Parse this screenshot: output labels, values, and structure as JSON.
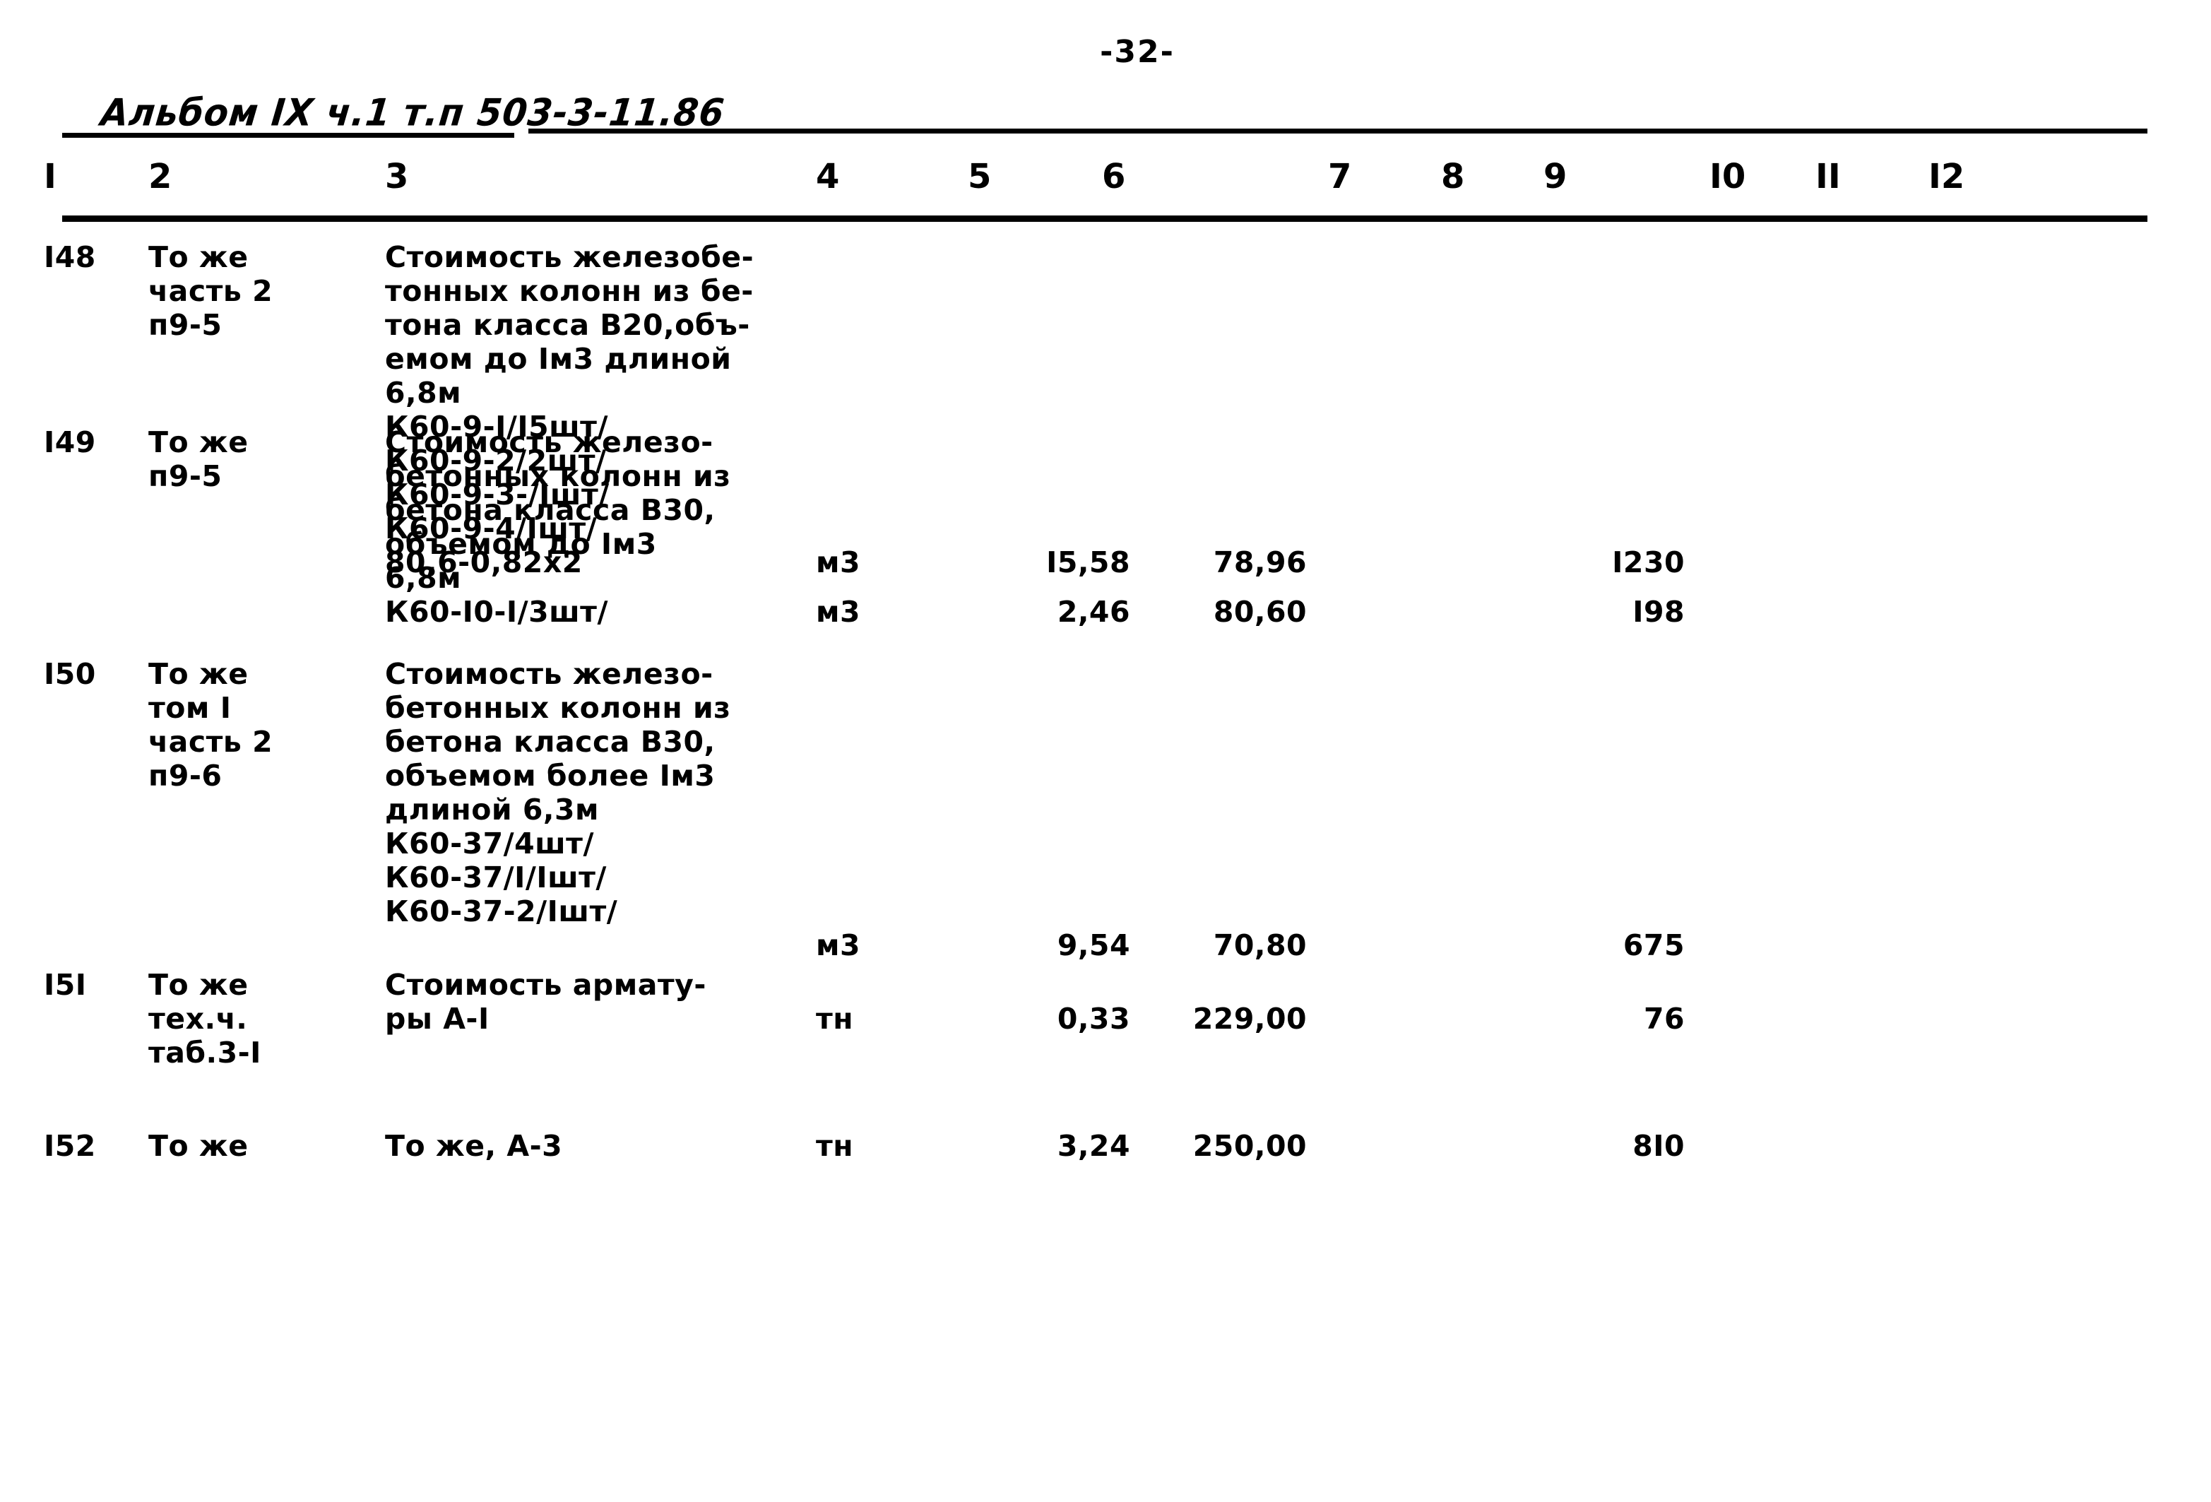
{
  "page": {
    "page_number": "-32-",
    "album_caption": "Альбом IX ч.1 т.п 503-3-11.86"
  },
  "table": {
    "column_headers": [
      "I",
      "2",
      "3",
      "4",
      "5",
      "6",
      "7",
      "8",
      "9",
      "I0",
      "II",
      "I2"
    ],
    "rows": [
      {
        "c1": "I48",
        "c2": "То же\nчасть 2\nп9-5",
        "c3": "Стоимость железобе-\nтонных колонн из бе-\nтона класса В20,объ-\nемом до Iм3 длиной\n6,8м\nК60-9-I/I5шт/\nК60-9-2/2шт/\nК60-9-3-/Iшт/\nК60-9-4/Iшт/\n80,6-0,82х2",
        "c4": "м3",
        "c5": "I5,58",
        "c6": "78,96",
        "c7": "",
        "c8": "",
        "c9": "I230",
        "c10": "",
        "c11": "",
        "c12": ""
      },
      {
        "c1": "I49",
        "c2": "То же\nп9-5",
        "c3": "Стоимость железо-\nбетонных колонн из\nбетона класса В30,\nобъемом до Iм3\n6,8м\nК60-I0-I/3шт/",
        "c4": "м3",
        "c5": "2,46",
        "c6": "80,60",
        "c7": "",
        "c8": "",
        "c9": "I98",
        "c10": "",
        "c11": "",
        "c12": ""
      },
      {
        "c1": "I50",
        "c2": "То же\nтом I\nчасть 2\nп9-6",
        "c3": "Стоимость железо-\nбетонных колонн из\nбетона класса В30,\nобъемом более Iм3\nдлиной 6,3м\nК60-37/4шт/\nК60-37/I/Iшт/\nК60-37-2/Iшт/",
        "c4": "м3",
        "c5": "9,54",
        "c6": "70,80",
        "c7": "",
        "c8": "",
        "c9": "675",
        "c10": "",
        "c11": "",
        "c12": ""
      },
      {
        "c1": "I5I",
        "c2": "То же\nтех.ч.\nтаб.3-I",
        "c3": "Стоимость армату-\nры А-I",
        "c4": "тн",
        "c5": "0,33",
        "c6": "229,00",
        "c7": "",
        "c8": "",
        "c9": "76",
        "c10": "",
        "c11": "",
        "c12": ""
      },
      {
        "c1": "I52",
        "c2": "То же",
        "c3": "То же, А-3",
        "c4": "тн",
        "c5": "3,24",
        "c6": "250,00",
        "c7": "",
        "c8": "",
        "c9": "8I0",
        "c10": "",
        "c11": "",
        "c12": ""
      }
    ]
  },
  "layout": {
    "column_x": [
      62,
      210,
      545,
      1155,
      1370,
      1560,
      1880,
      2040,
      2185,
      2420,
      2570,
      2730
    ],
    "row_tops": [
      0,
      262,
      590,
      1030,
      1258
    ],
    "row_value_line": [
      9,
      5,
      8,
      1,
      0
    ]
  }
}
